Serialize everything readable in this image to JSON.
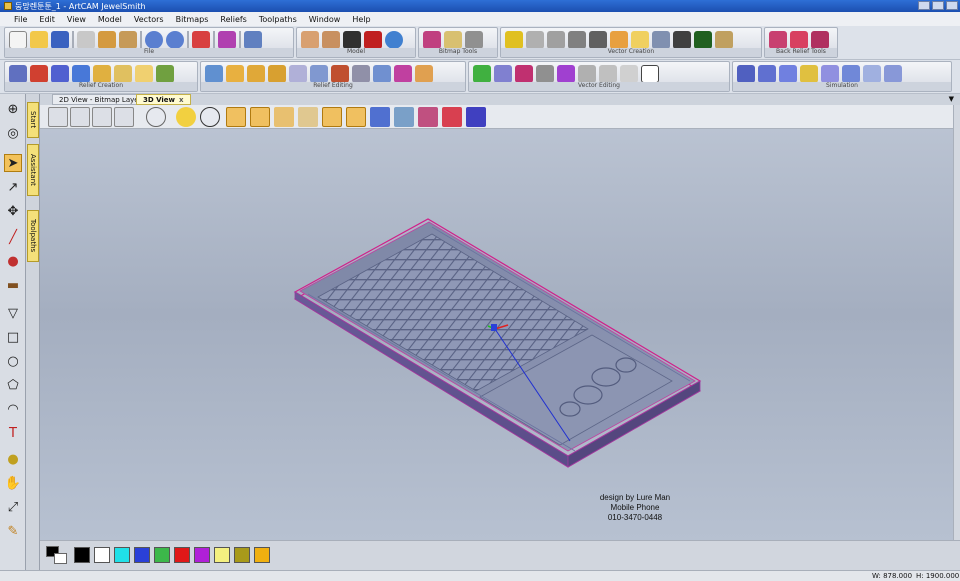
{
  "window": {
    "title": "둥망렌툰툰_1 - ArtCAM JewelSmith"
  },
  "menu": [
    "File",
    "Edit",
    "View",
    "Model",
    "Vectors",
    "Bitmaps",
    "Reliefs",
    "Toolpaths",
    "Window",
    "Help"
  ],
  "toolbar_groups_row1": [
    {
      "label": "File"
    },
    {
      "label": "Model"
    },
    {
      "label": "Bitmap Tools"
    },
    {
      "label": "Vector Creation"
    },
    {
      "label": "Back Relief Tools"
    }
  ],
  "toolbar_groups_row2": [
    {
      "label": "Relief Creation"
    },
    {
      "label": "Relief Editing"
    },
    {
      "label": "Vector Editing"
    },
    {
      "label": "Simulation"
    }
  ],
  "side_tabs": [
    "Start",
    "Assistant",
    "Toolpaths"
  ],
  "doc_tabs": [
    {
      "label": "2D View - Bitmap Layer",
      "active": false
    },
    {
      "label": "3D View",
      "active": true,
      "close": "x"
    }
  ],
  "doc_tab_menu_arrow": "▼",
  "viewport": {
    "note_lines": [
      "design by Lure Man",
      "Mobile Phone",
      "010-3470-0448"
    ]
  },
  "palette": {
    "colors": [
      "#000000",
      "#ffffff",
      "#20e0e8",
      "#2a40d8",
      "#3cb84a",
      "#e01818",
      "#b020d8",
      "#f4f080",
      "#a89a1a",
      "#f0b010"
    ]
  },
  "status": {
    "width": "W: 878.000",
    "height": "H: 1900.000"
  },
  "accent_colors": {
    "highlight": "#f0c060",
    "title_bar": "#1c4fb0",
    "model_outline": "#d0208a"
  }
}
